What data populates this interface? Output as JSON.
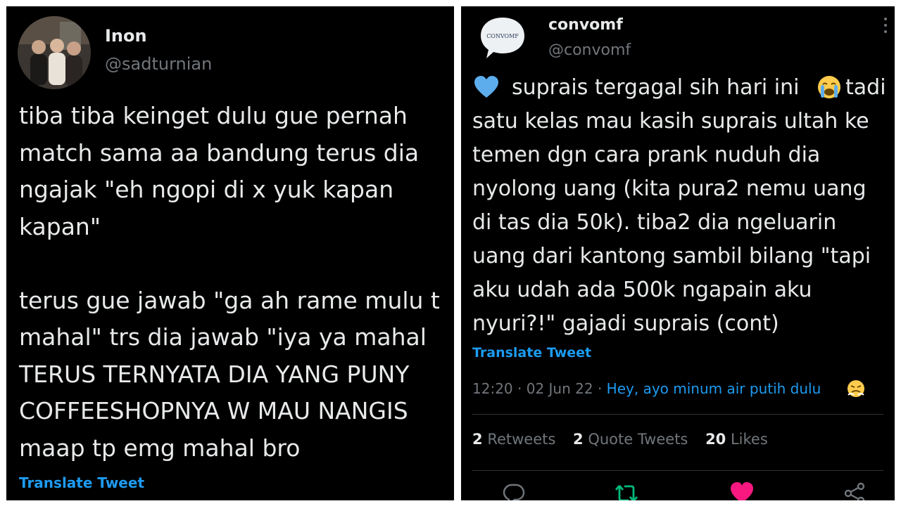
{
  "left_tweet": {
    "display_name": "Inon",
    "handle": "@sadturnian",
    "text": "tiba tiba keinget dulu gue pernah\nmatch sama aa bandung terus dia\nngajak \"eh ngopi di x yuk kapan\nkapan\"\n\nterus gue jawab \"ga ah rame mulu t\nmahal\" trs dia jawab \"iya ya mahal\nTERUS TERNYATA DIA YANG PUNY\nCOFFEESHOPNYA W MAU NANGIS\nmaap tp emg mahal bro",
    "translate_label": "Translate Tweet"
  },
  "right_tweet": {
    "display_name": "convomf",
    "handle": "@convomf",
    "avatar_text": "CONVOMF",
    "text_first_line": "suprais tergagal sih hari ini",
    "text_first_line_tail": "tadi",
    "text": "satu kelas mau kasih suprais ultah ke\ntemen dgn cara prank nuduh dia\nnyolong uang (kita pura2 nemu uang\ndi tas dia 50k). tiba2 dia ngeluarin\nuang dari kantong sambil bilang \"tapi\naku udah ada 500k ngapain aku\nnyuri?!\" gajadi suprais (cont)",
    "translate_label": "Translate Tweet",
    "time": "12:20",
    "date": "02 Jun 22",
    "source": "Hey, ayo minum air putih dulu",
    "stats": {
      "retweets_count": "2",
      "retweets_label": "Retweets",
      "quotes_count": "2",
      "quotes_label": "Quote Tweets",
      "likes_count": "20",
      "likes_label": "Likes"
    }
  },
  "colors": {
    "background": "#000000",
    "text": "#e7e9ea",
    "muted": "#71767b",
    "link": "#1d9bf0",
    "retweet": "#00ba7c",
    "like": "#f91880"
  },
  "icons": [
    "blue-heart-icon",
    "crying-face-icon",
    "steaming-face-icon",
    "reply-icon",
    "retweet-icon",
    "like-icon",
    "share-icon",
    "more-options-icon"
  ]
}
